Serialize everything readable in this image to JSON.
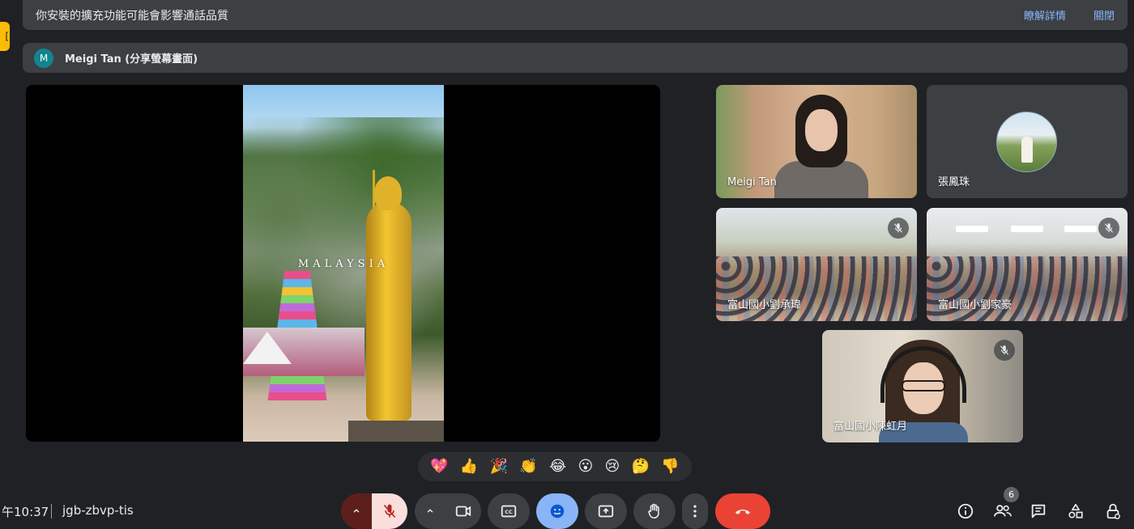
{
  "banner": {
    "message": "你安裝的擴充功能可能會影響通話品質",
    "learn_more": "瞭解詳情",
    "close": "關閉"
  },
  "presenter": {
    "avatar_letter": "M",
    "label": "Meigi Tan (分享螢幕畫面)"
  },
  "shared_screen": {
    "caption": "MALAYSIA"
  },
  "participants": [
    {
      "name": "Meigi Tan",
      "muted": false
    },
    {
      "name": "張鳳珠",
      "muted": false
    },
    {
      "name": "富山國小劉承瑋",
      "muted": true
    },
    {
      "name": "富山國小劉家豪",
      "muted": true
    },
    {
      "name": "富山國小陳虹月",
      "muted": true
    }
  ],
  "reactions": [
    "💖",
    "👍",
    "🎉",
    "👏",
    "😂",
    "😮",
    "😢",
    "🤔",
    "👎"
  ],
  "bottom_bar": {
    "time": "午10:37",
    "meeting_code": "jgb-zbvp-tis",
    "people_count": "6"
  },
  "colors": {
    "background": "#202124",
    "surface": "#3c4043",
    "link": "#8ab4f8",
    "mic_off_red": "#f28b82",
    "end_call": "#ea4335",
    "reaction_active": "#8ab4f8"
  },
  "icons": {
    "mic": "mic-off-icon",
    "camera": "videocam-icon",
    "captions": "closed-caption-icon",
    "reactions": "emoji-icon",
    "present": "present-screen-icon",
    "hand": "raise-hand-icon",
    "more": "more-vert-icon",
    "end": "call-end-icon",
    "info": "info-icon",
    "people": "people-icon",
    "chat": "chat-icon",
    "activities": "activities-icon",
    "host": "host-controls-icon"
  }
}
